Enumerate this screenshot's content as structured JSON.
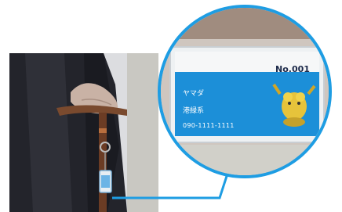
{
  "name_tag": {
    "number": "No.001",
    "name": "ヤマダ",
    "place": "港緑系",
    "phone": "090-1111-1111",
    "card_color": "#1c8fd8",
    "ring_color": "#1e9de3"
  },
  "scene": {
    "subject": "elderly person holding a cane with a name tag attached",
    "mascot_icon": "yellow-mascot-icon"
  }
}
